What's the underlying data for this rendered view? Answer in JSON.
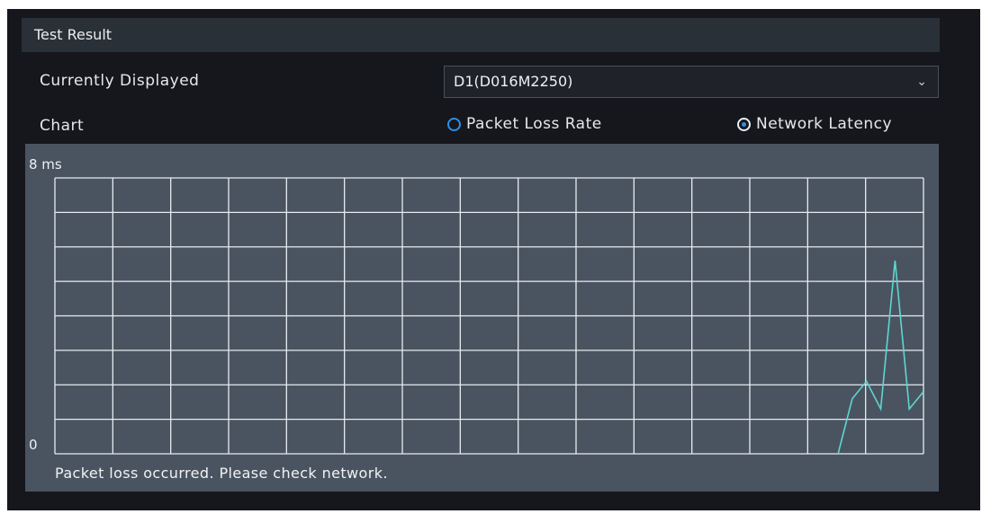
{
  "header": {
    "title": "Test Result"
  },
  "displayed": {
    "label": "Currently Displayed",
    "value": "D1(D016M2250)",
    "chevron_icon": "chevron-down-icon"
  },
  "chart_row": {
    "label": "Chart",
    "options": [
      {
        "label": "Packet Loss Rate",
        "selected": false
      },
      {
        "label": "Network Latency",
        "selected": true
      }
    ]
  },
  "chart_data": {
    "type": "line",
    "title": "",
    "ylabel": "",
    "xlabel": "",
    "y_top_label": "8 ms",
    "y_bottom_label": "0",
    "ylim": [
      0,
      8
    ],
    "grid": true,
    "series": [
      {
        "color": "#5fd6cf",
        "x": [
          0,
          0.5,
          1,
          1.5,
          2,
          2.5,
          3
        ],
        "y": [
          0,
          1.6,
          2.1,
          1.3,
          5.6,
          1.3,
          1.8
        ]
      }
    ],
    "x_range": [
      -27.5,
      3
    ]
  },
  "status": {
    "message": "Packet loss occurred. Please check network."
  },
  "colors": {
    "accent": "#2f8fe6",
    "line": "#5fd6cf",
    "grid": "#e6ebef"
  }
}
